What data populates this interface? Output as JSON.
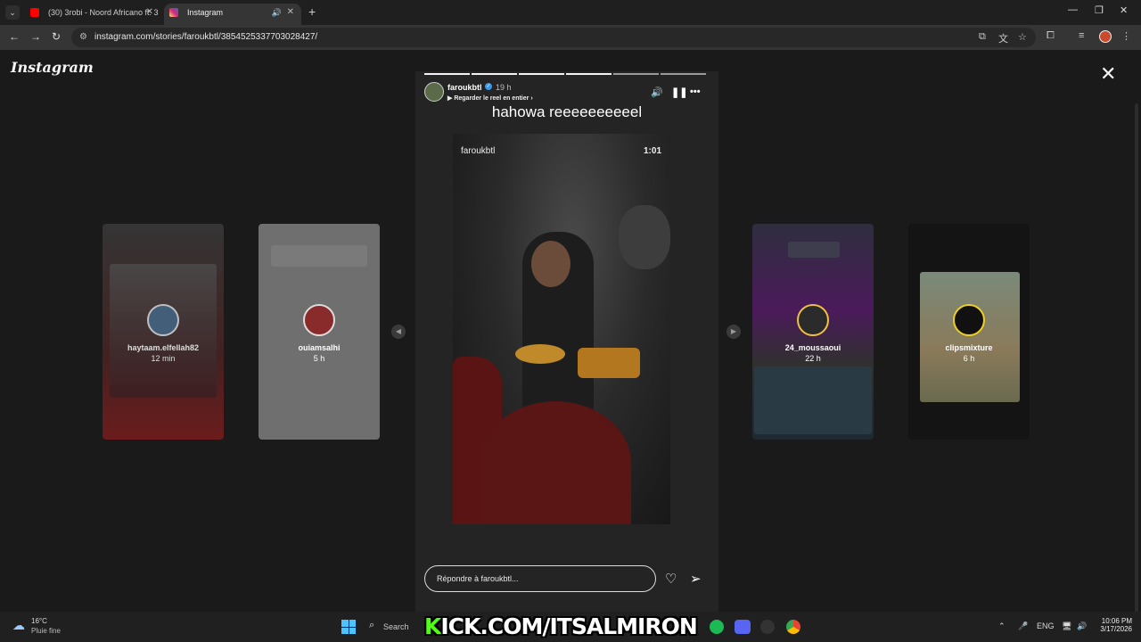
{
  "browser": {
    "tabs": [
      {
        "title": "(30) 3robi - Noord Africano ft. 3",
        "favicon_color": "#ff0000",
        "icon": "youtube-icon"
      },
      {
        "title": "Instagram",
        "favicon_color": "#d6249f",
        "icon": "instagram-icon",
        "active": true
      }
    ],
    "url": "instagram.com/stories/faroukbtl/3854525337703028427/"
  },
  "instagram": {
    "logo": "Instagram",
    "story": {
      "username": "faroukbtl",
      "time": "19 h",
      "reel_link": "Regarder le reel en entier",
      "caption": "hahowa reeeeeeeeeel",
      "video_username": "faroukbtl",
      "video_duration": "1:01",
      "reply_placeholder": "Répondre à faroukbtl...",
      "progress_segments": 6,
      "active_segment": 4
    },
    "side_stories": [
      {
        "username": "haytaam.elfellah82",
        "time": "12 min"
      },
      {
        "username": "ouiamsalhi",
        "time": "5 h"
      },
      {
        "username": "24_moussaoui",
        "time": "22 h"
      },
      {
        "username": "clipsmixture",
        "time": "6 h"
      }
    ]
  },
  "taskbar": {
    "weather_temp": "16°C",
    "weather_desc": "Pluie fine",
    "search_label": "Search",
    "banner_prefix": "K",
    "banner_text": "ICK.COM/ITSALMIRON",
    "lang": "ENG",
    "time": "10:06 PM",
    "date": "3/17/2026"
  },
  "colors": {
    "kick_green": "#53fc18",
    "verified_blue": "#3897f0",
    "windows_blue": "#4cc2ff"
  }
}
